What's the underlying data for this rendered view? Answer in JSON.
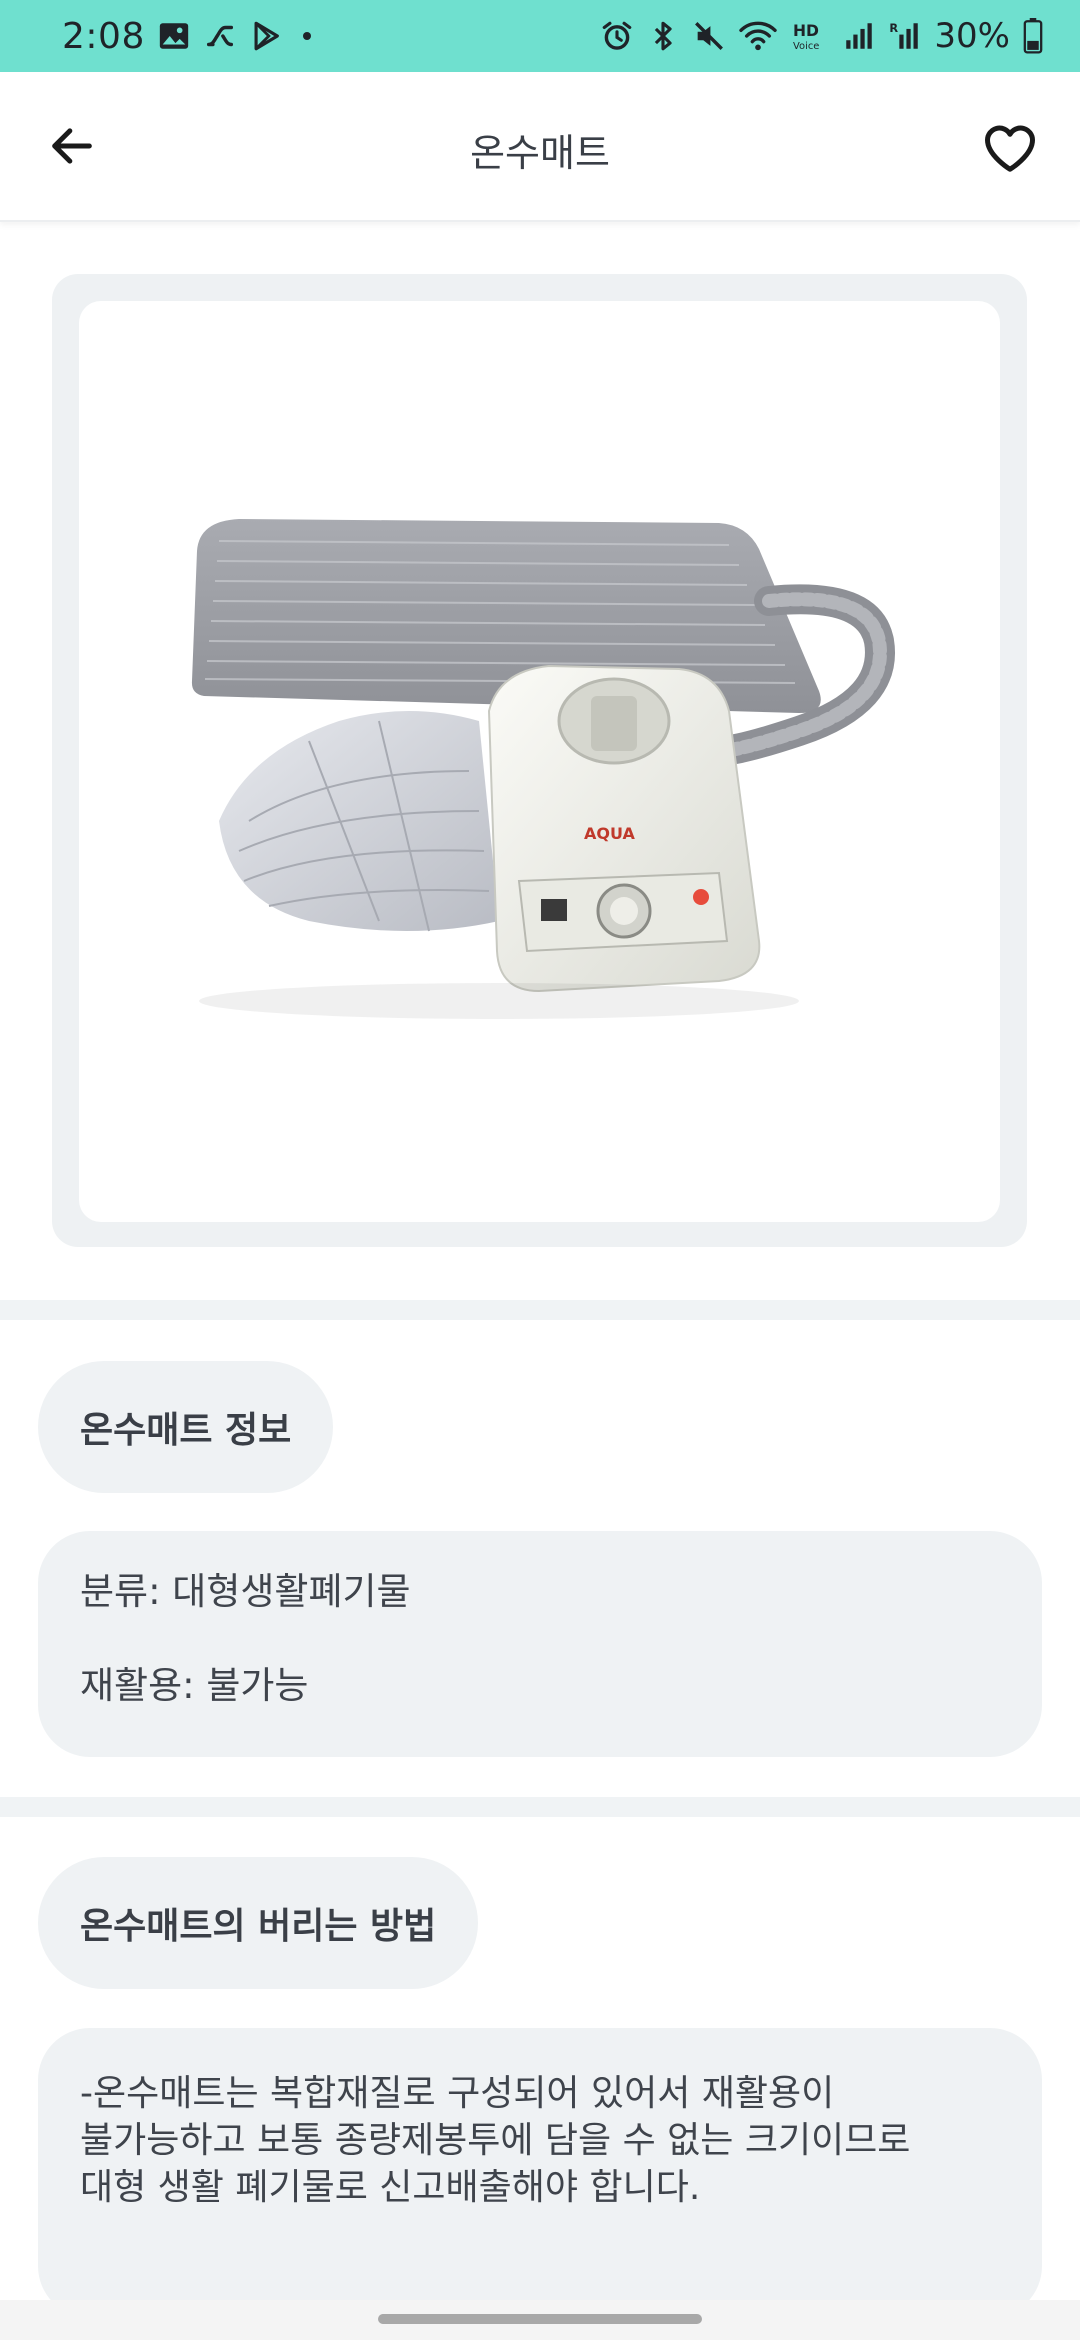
{
  "status_bar": {
    "time": "2:08",
    "battery_text": "30%",
    "left_icons": [
      "gallery-icon",
      "link-icon",
      "play-store-icon",
      "dot-icon"
    ],
    "right_icons": [
      "alarm-icon",
      "bluetooth-icon",
      "mute-icon",
      "wifi-icon",
      "hd-voice-icon",
      "signal-icon",
      "signal-roaming-icon",
      "battery-icon"
    ]
  },
  "app_bar": {
    "title": "온수매트",
    "back_icon": "arrow-left-icon",
    "favorite_icon": "heart-outline-icon"
  },
  "product": {
    "image_icon": "water-heated-mat-with-control-unit",
    "brand_text": "AQUA"
  },
  "info_section": {
    "chip_label": "온수매트 정보",
    "category_line": "분류: 대형생활폐기물",
    "recycle_line": "재활용: 불가능"
  },
  "disposal_section": {
    "chip_label": "온수매트의 버리는 방법",
    "description": "-온수매트는 복합재질로 구성되어 있어서 재활용이\n불가능하고 보통 종량제봉투에 담을 수 없는 크기이므로\n대형 생활 폐기물로 신고배출해야 합니다."
  },
  "colors": {
    "status_bar": "#6fe0cf",
    "chip_bg": "#eff2f4",
    "text": "#3a3f47"
  }
}
